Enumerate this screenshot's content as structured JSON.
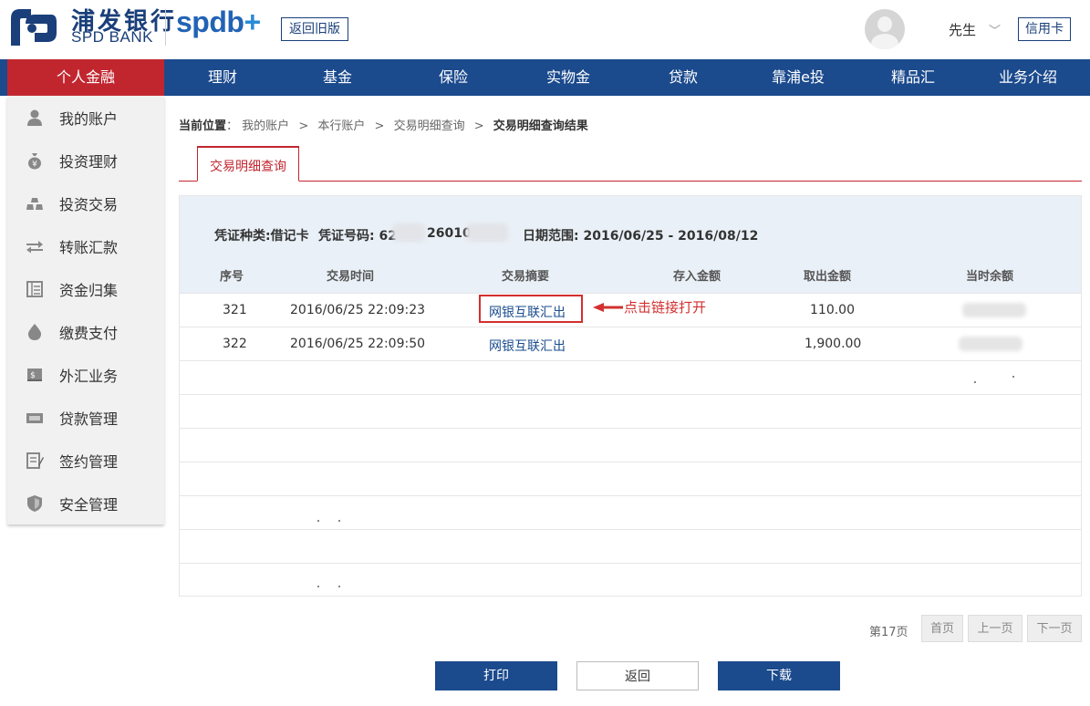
{
  "header": {
    "logo_cn": "浦发银行",
    "logo_en": "SPD BANK",
    "spdb_text": "spdb",
    "spdb_plus": "+",
    "old_version_label": "返回旧版",
    "user_name": "先生",
    "chevron": "﹀",
    "credit_card_label": "信用卡"
  },
  "nav": {
    "items": [
      {
        "label": "个人金融",
        "active": true
      },
      {
        "label": "理财"
      },
      {
        "label": "基金"
      },
      {
        "label": "保险"
      },
      {
        "label": "实物金"
      },
      {
        "label": "贷款"
      },
      {
        "label": "靠浦e投"
      },
      {
        "label": "精品汇"
      },
      {
        "label": "业务介绍"
      }
    ]
  },
  "sidebar": {
    "items": [
      {
        "label": "我的账户",
        "icon": "user-icon"
      },
      {
        "label": "投资理财",
        "icon": "money-bag-icon"
      },
      {
        "label": "投资交易",
        "icon": "gold-bars-icon"
      },
      {
        "label": "转账汇款",
        "icon": "transfer-icon"
      },
      {
        "label": "资金归集",
        "icon": "ledger-icon"
      },
      {
        "label": "缴费支付",
        "icon": "drop-icon"
      },
      {
        "label": "外汇业务",
        "icon": "currency-icon"
      },
      {
        "label": "贷款管理",
        "icon": "loan-icon"
      },
      {
        "label": "签约管理",
        "icon": "contract-icon"
      },
      {
        "label": "安全管理",
        "icon": "shield-icon"
      }
    ]
  },
  "breadcrumb": {
    "prefix": "当前位置",
    "colon": "：",
    "path": [
      "我的账户",
      "本行账户",
      "交易明细查询"
    ],
    "separator": ">",
    "current": "交易明细查询结果"
  },
  "tab": {
    "label": "交易明细查询"
  },
  "info": {
    "voucher_type": "凭证种类:借记卡",
    "voucher_no_label": "凭证号码: 62",
    "voucher_no_mid": "26010",
    "date_range": "日期范围: 2016/06/25 - 2016/08/12"
  },
  "table": {
    "headers": [
      "序号",
      "交易时间",
      "交易摘要",
      "存入金额",
      "取出金额",
      "当时余额"
    ],
    "rows": [
      {
        "no": "321",
        "time": "2016/06/25 22:09:23",
        "summary": "网银互联汇出",
        "deposit": "",
        "withdraw": "110.00"
      },
      {
        "no": "322",
        "time": "2016/06/25 22:09:50",
        "summary": "网银互联汇出",
        "deposit": "",
        "withdraw": "1,900.00"
      }
    ]
  },
  "annotation": {
    "text": "点击链接打开",
    "color": "#d2302f"
  },
  "pagination": {
    "page_label": "第17页",
    "first": "首页",
    "prev": "上一页",
    "next": "下一页"
  },
  "actions": {
    "print": "打印",
    "back": "返回",
    "download": "下载"
  },
  "colors": {
    "nav_blue": "#1b4a8d",
    "accent_red": "#c1262f",
    "link_blue": "#1a4c8e"
  }
}
